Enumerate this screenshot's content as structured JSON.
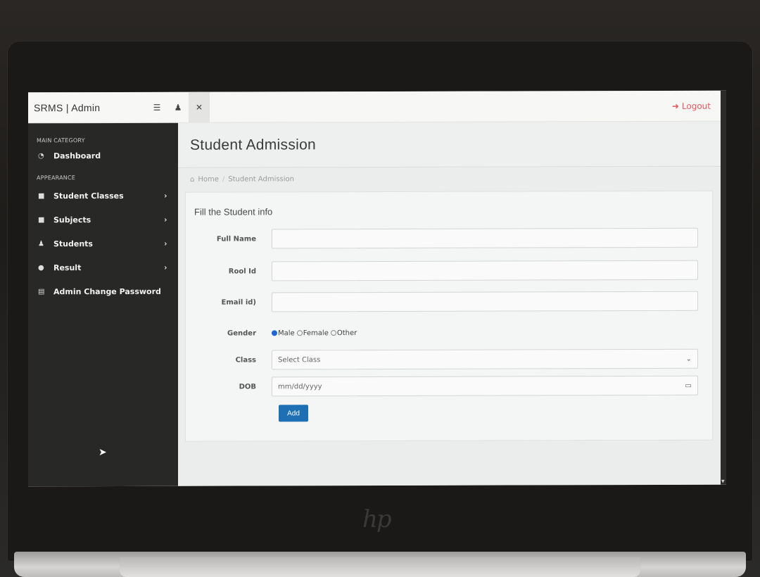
{
  "app": {
    "brand": "SRMS | Admin",
    "logout_label": "Logout"
  },
  "topbar": {
    "icons": [
      "list-icon",
      "user-icon",
      "expand-icon"
    ]
  },
  "sidebar": {
    "section1": "MAIN CATEGORY",
    "section2": "APPEARANCE",
    "items": [
      {
        "label": "Dashboard",
        "icon": "dashboard-icon",
        "has_submenu": false
      },
      {
        "label": "Student Classes",
        "icon": "file-icon",
        "has_submenu": true
      },
      {
        "label": "Subjects",
        "icon": "file-icon",
        "has_submenu": true
      },
      {
        "label": "Students",
        "icon": "users-icon",
        "has_submenu": true
      },
      {
        "label": "Result",
        "icon": "info-icon",
        "has_submenu": true
      },
      {
        "label": "Admin Change Password",
        "icon": "server-icon",
        "has_submenu": false
      }
    ]
  },
  "main": {
    "title": "Student Admission",
    "breadcrumb": {
      "home": "Home",
      "current": "Student Admission"
    },
    "card_title": "Fill the Student info",
    "form": {
      "full_name_label": "Full Name",
      "full_name_value": "",
      "roll_label": "Rool Id",
      "roll_value": "",
      "email_label": "Email id)",
      "email_value": "",
      "gender_label": "Gender",
      "gender_options": [
        "Male",
        "Female",
        "Other"
      ],
      "gender_selected": "Male",
      "class_label": "Class",
      "class_value": "Select Class",
      "dob_label": "DOB",
      "dob_placeholder": "mm/dd/yyyy",
      "submit_label": "Add"
    }
  },
  "colors": {
    "sidebar_bg": "#282826",
    "accent": "#1f6fb5",
    "logout": "#e8555a"
  }
}
